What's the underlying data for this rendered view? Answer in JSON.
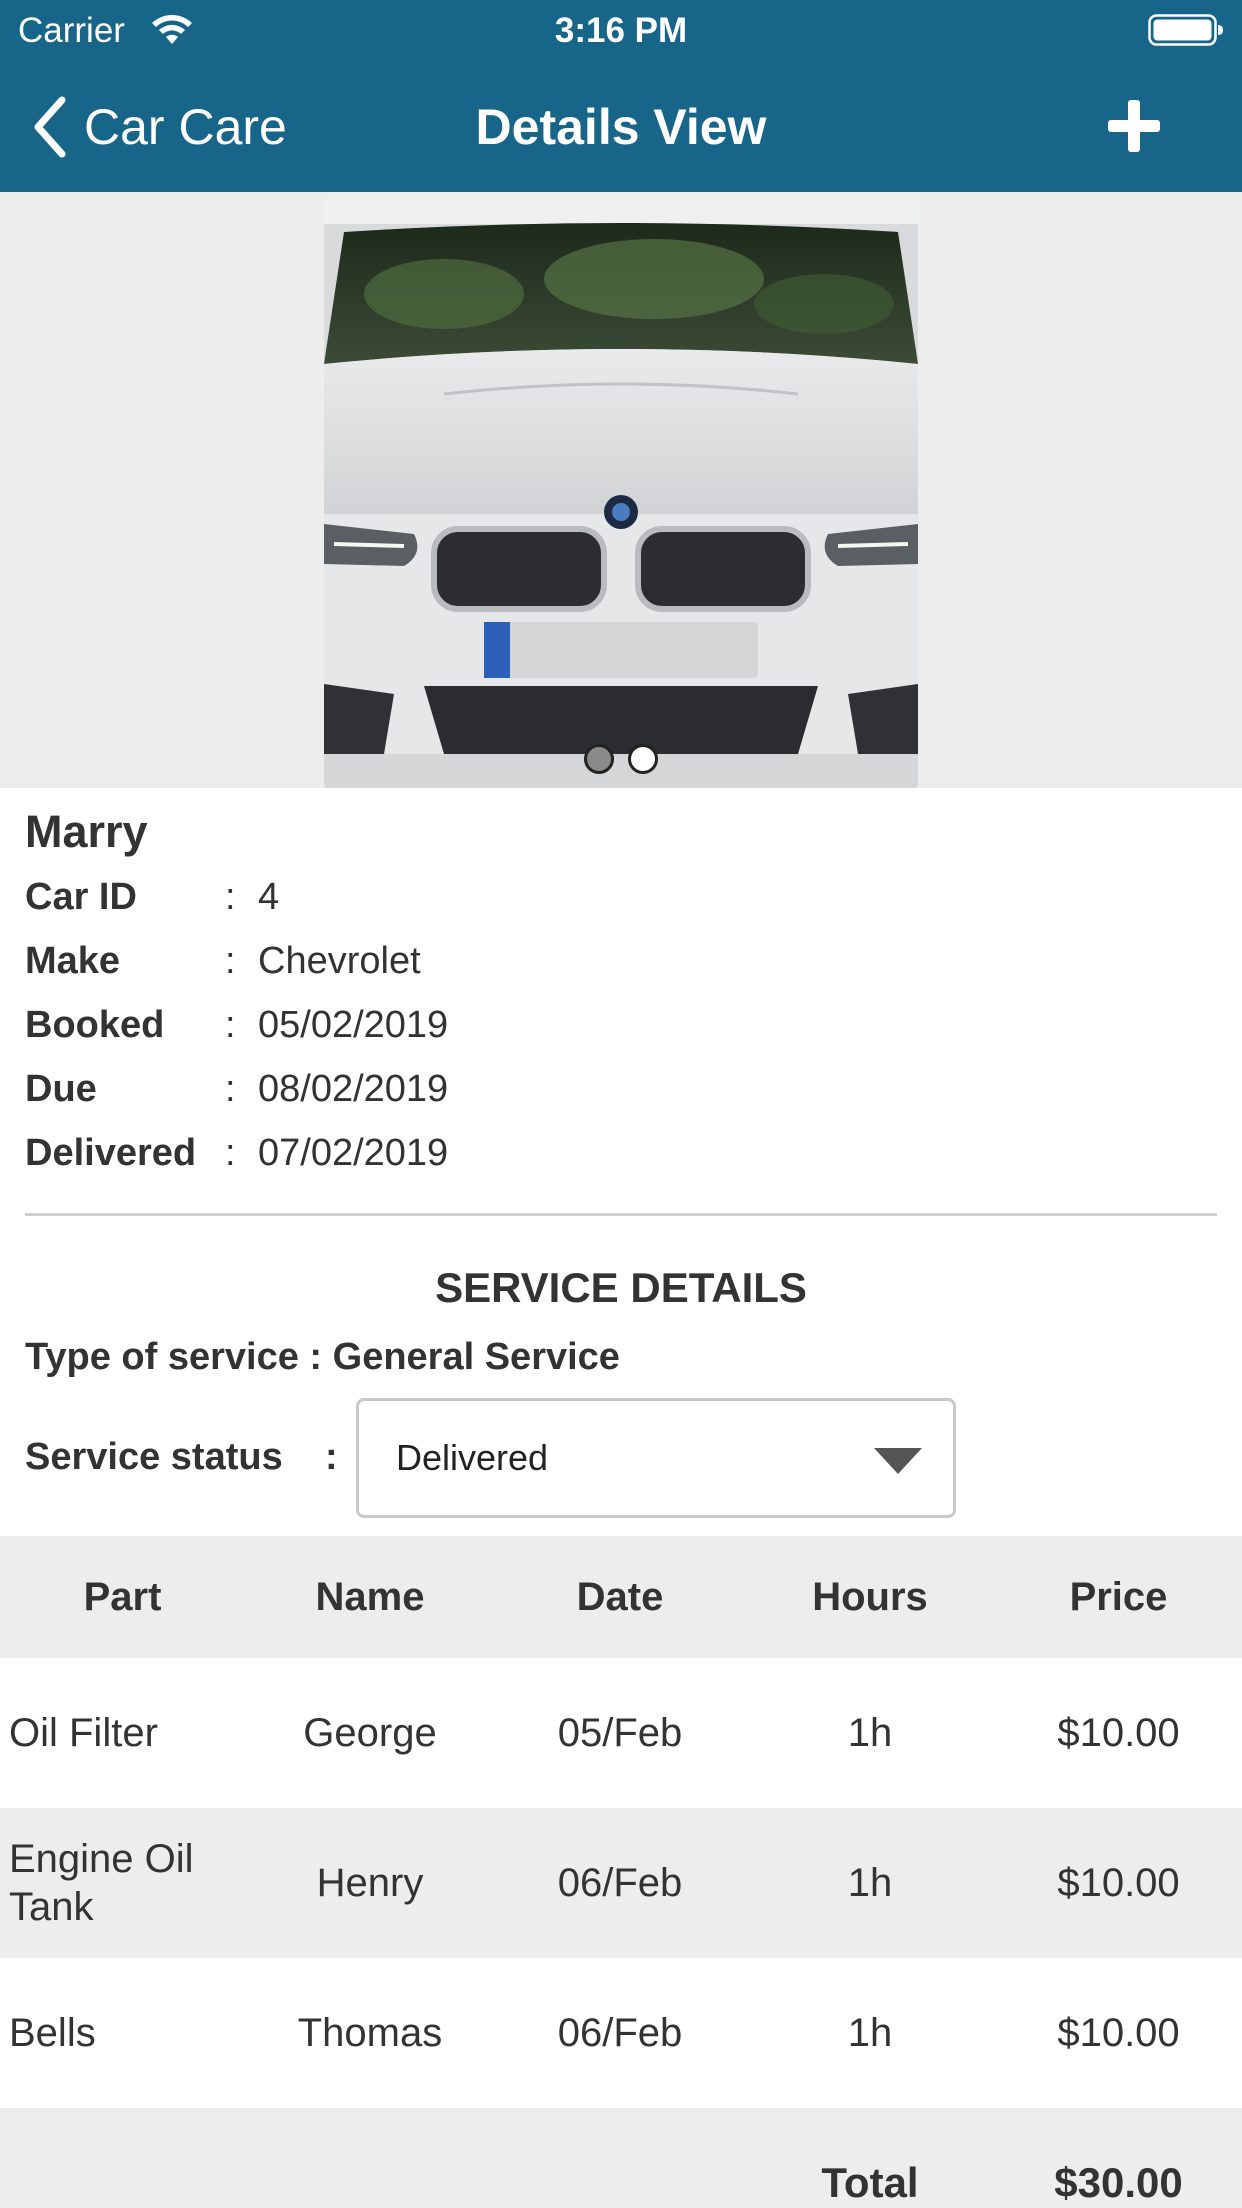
{
  "status_bar": {
    "carrier": "Carrier",
    "time": "3:16 PM"
  },
  "nav": {
    "back_label": "Car Care",
    "title": "Details View",
    "add_icon": "plus-icon"
  },
  "gallery": {
    "image": "white car front photo",
    "page_count": 2,
    "current_page": 2
  },
  "owner": {
    "name": "Marry",
    "fields": [
      {
        "label": "Car ID",
        "colon": ":",
        "value": "4"
      },
      {
        "label": "Make",
        "colon": ":",
        "value": "Chevrolet"
      },
      {
        "label": "Booked",
        "colon": ":",
        "value": "05/02/2019"
      },
      {
        "label": "Due",
        "colon": ":",
        "value": "08/02/2019"
      },
      {
        "label": "Delivered",
        "colon": ":",
        "value": "07/02/2019"
      }
    ]
  },
  "service": {
    "title": "SERVICE DETAILS",
    "type_text": "Type of service : General Service",
    "status_label": "Service status",
    "status_colon": ":",
    "status_value": "Delivered"
  },
  "table": {
    "headers": {
      "part": "Part",
      "name": "Name",
      "date": "Date",
      "hours": "Hours",
      "price": "Price"
    },
    "rows": [
      {
        "part": "Oil Filter",
        "name": "George",
        "date": "05/Feb",
        "hours": "1h",
        "price": "$10.00"
      },
      {
        "part": "Engine Oil Tank",
        "name": "Henry",
        "date": "06/Feb",
        "hours": "1h",
        "price": "$10.00"
      },
      {
        "part": "Bells",
        "name": "Thomas",
        "date": "06/Feb",
        "hours": "1h",
        "price": "$10.00"
      }
    ],
    "total_label": "Total",
    "total_value": "$30.00"
  },
  "colors": {
    "nav_bg": "#17668a",
    "stripe_bg": "#ededed",
    "text": "#333333"
  }
}
